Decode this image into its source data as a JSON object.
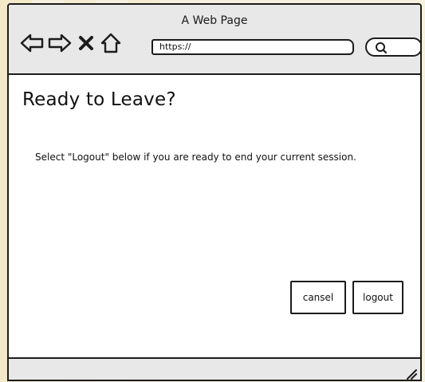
{
  "window": {
    "title": "A Web Page"
  },
  "toolbar": {
    "back_icon": "back-arrow-icon",
    "forward_icon": "forward-arrow-icon",
    "stop_icon": "close-icon",
    "home_icon": "home-icon",
    "search_icon": "search-icon"
  },
  "address_bar": {
    "url": "https://"
  },
  "dialog": {
    "heading": "Ready to Leave?",
    "message": "Select \"Logout\" below if you are ready to end your current session.",
    "cancel_label": "cansel",
    "logout_label": "logout"
  },
  "colors": {
    "background": "#f6f1dd",
    "chrome": "#e8e8e8",
    "content": "#ffffff",
    "stroke": "#1c1c1c"
  }
}
